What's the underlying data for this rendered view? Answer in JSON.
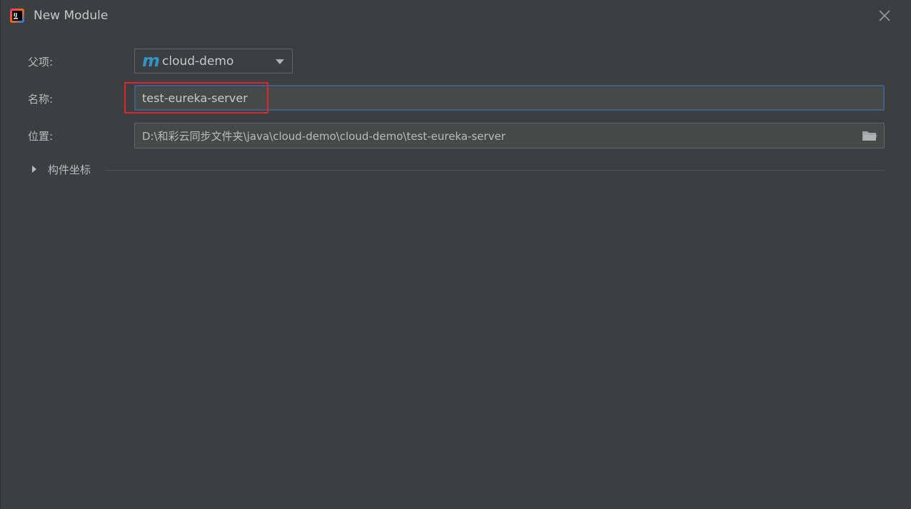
{
  "window": {
    "title": "New Module",
    "app_icon": "intellij-idea-icon",
    "close_icon": "close-icon"
  },
  "form": {
    "parent": {
      "label": "父项:",
      "value": "cloud-demo",
      "icon": "maven-module-icon",
      "icon_glyph": "m"
    },
    "name": {
      "label": "名称:",
      "value": "test-eureka-server"
    },
    "location": {
      "label": "位置:",
      "value": "D:\\和彩云同步文件夹\\java\\cloud-demo\\cloud-demo\\test-eureka-server",
      "icon": "folder-icon"
    },
    "artifact_section": {
      "label": "构件坐标",
      "expanded": false
    }
  },
  "colors": {
    "background": "#3c3f41",
    "text": "#bbbbbb",
    "focus_border": "#3d6185",
    "highlight_box": "#e0262d",
    "maven_blue": "#3592c4"
  }
}
